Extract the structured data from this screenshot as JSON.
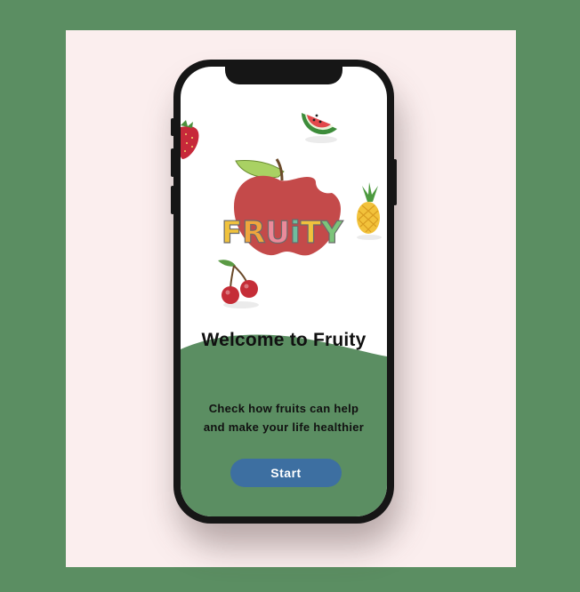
{
  "app": {
    "logo_text": "FRUITY"
  },
  "welcome": {
    "title": "Welcome to Fruity",
    "subtitle_line1": "Check how fruits can help",
    "subtitle_line2": "and make your life healthier"
  },
  "actions": {
    "start_label": "Start"
  },
  "colors": {
    "background": "#5b8e62",
    "card": "#fbeeee",
    "wave": "#5b8e62",
    "button": "#3d6fa1",
    "apple": "#c44a4a"
  },
  "icons": [
    "watermelon-icon",
    "strawberry-icon",
    "apple-logo-icon",
    "pineapple-icon",
    "cherry-icon"
  ]
}
